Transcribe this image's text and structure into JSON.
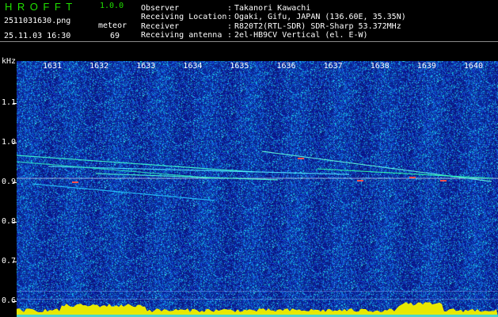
{
  "app": {
    "title": "HROFFT",
    "version": "1.0.0"
  },
  "file": {
    "filename": "2511031630.png",
    "datetime": "25.11.03 16:30"
  },
  "meteor": {
    "label": "meteor",
    "count": "69"
  },
  "observer_info": [
    {
      "label": "Observer",
      "value": "Takanori Kawachi"
    },
    {
      "label": "Receiving Location",
      "value": "Ogaki, Gifu, JAPAN (136.60E, 35.35N)"
    },
    {
      "label": "Receiver",
      "value": "R820T2(RTL-SDR) SDR-Sharp 53.372MHz"
    },
    {
      "label": "Receiving antenna",
      "value": "2el-HB9CV Vertical (el. E-W)"
    }
  ],
  "separator": ":",
  "axis": {
    "unit": "kHz",
    "freq_labels": [
      "1.1",
      "1.0",
      "0.9",
      "0.8",
      "0.7",
      "0.6"
    ],
    "freq_values": [
      1.1,
      1.0,
      0.9,
      0.8,
      0.7,
      0.6
    ],
    "time_labels": [
      "1631",
      "1632",
      "1633",
      "1634",
      "1635",
      "1636",
      "1637",
      "1638",
      "1639",
      "1640"
    ]
  },
  "colors": {
    "background": "#000000",
    "title_green": "#20e000",
    "spectrogram_base": "#0a1a9a",
    "text_white": "#ffffff",
    "power_yellow": "#e8e800"
  }
}
